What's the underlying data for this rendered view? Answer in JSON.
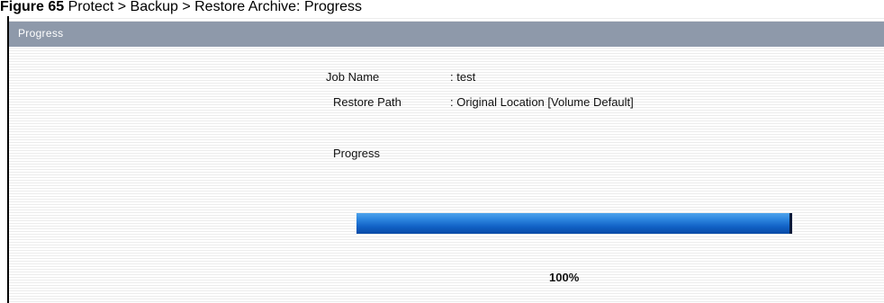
{
  "caption": {
    "figure_label": "Figure 65",
    "path": "Protect > Backup > Restore Archive: Progress"
  },
  "panel": {
    "title": "Progress"
  },
  "info": {
    "job_name_label": "Job Name",
    "job_name_value": ": test",
    "restore_path_label": "Restore Path",
    "restore_path_value": ": Original Location [Volume Default]",
    "progress_label": "Progress"
  },
  "progress": {
    "value": 1.0,
    "percent_text": "100%"
  }
}
